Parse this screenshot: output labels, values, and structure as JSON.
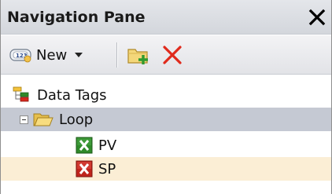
{
  "pane": {
    "title": "Navigation Pane",
    "close_icon": "close-x-icon"
  },
  "toolbar": {
    "new_label": "New",
    "new_icon": "new-tag-icon",
    "dropdown_icon": "caret-down-icon",
    "new_folder_icon": "new-folder-icon",
    "delete_icon": "delete-icon"
  },
  "tree": {
    "items": [
      {
        "label": "Data Tags",
        "icon": "data-tags-icon",
        "level": 0
      },
      {
        "label": "Loop",
        "icon": "folder-open-icon",
        "level": 1,
        "expanded": true,
        "selected": true
      },
      {
        "label": "PV",
        "icon": "excel-tag-green-icon",
        "level": 2
      },
      {
        "label": "SP",
        "icon": "excel-tag-red-icon",
        "level": 2,
        "hovered": true
      }
    ]
  },
  "colors": {
    "header_bg": "#dadde2",
    "selected_row_bg": "#c5c9d3",
    "hover_row_bg": "#fbeed5",
    "delete_red": "#e02a1c",
    "excel_green": "#2f8a2a",
    "excel_red": "#c0241c"
  }
}
